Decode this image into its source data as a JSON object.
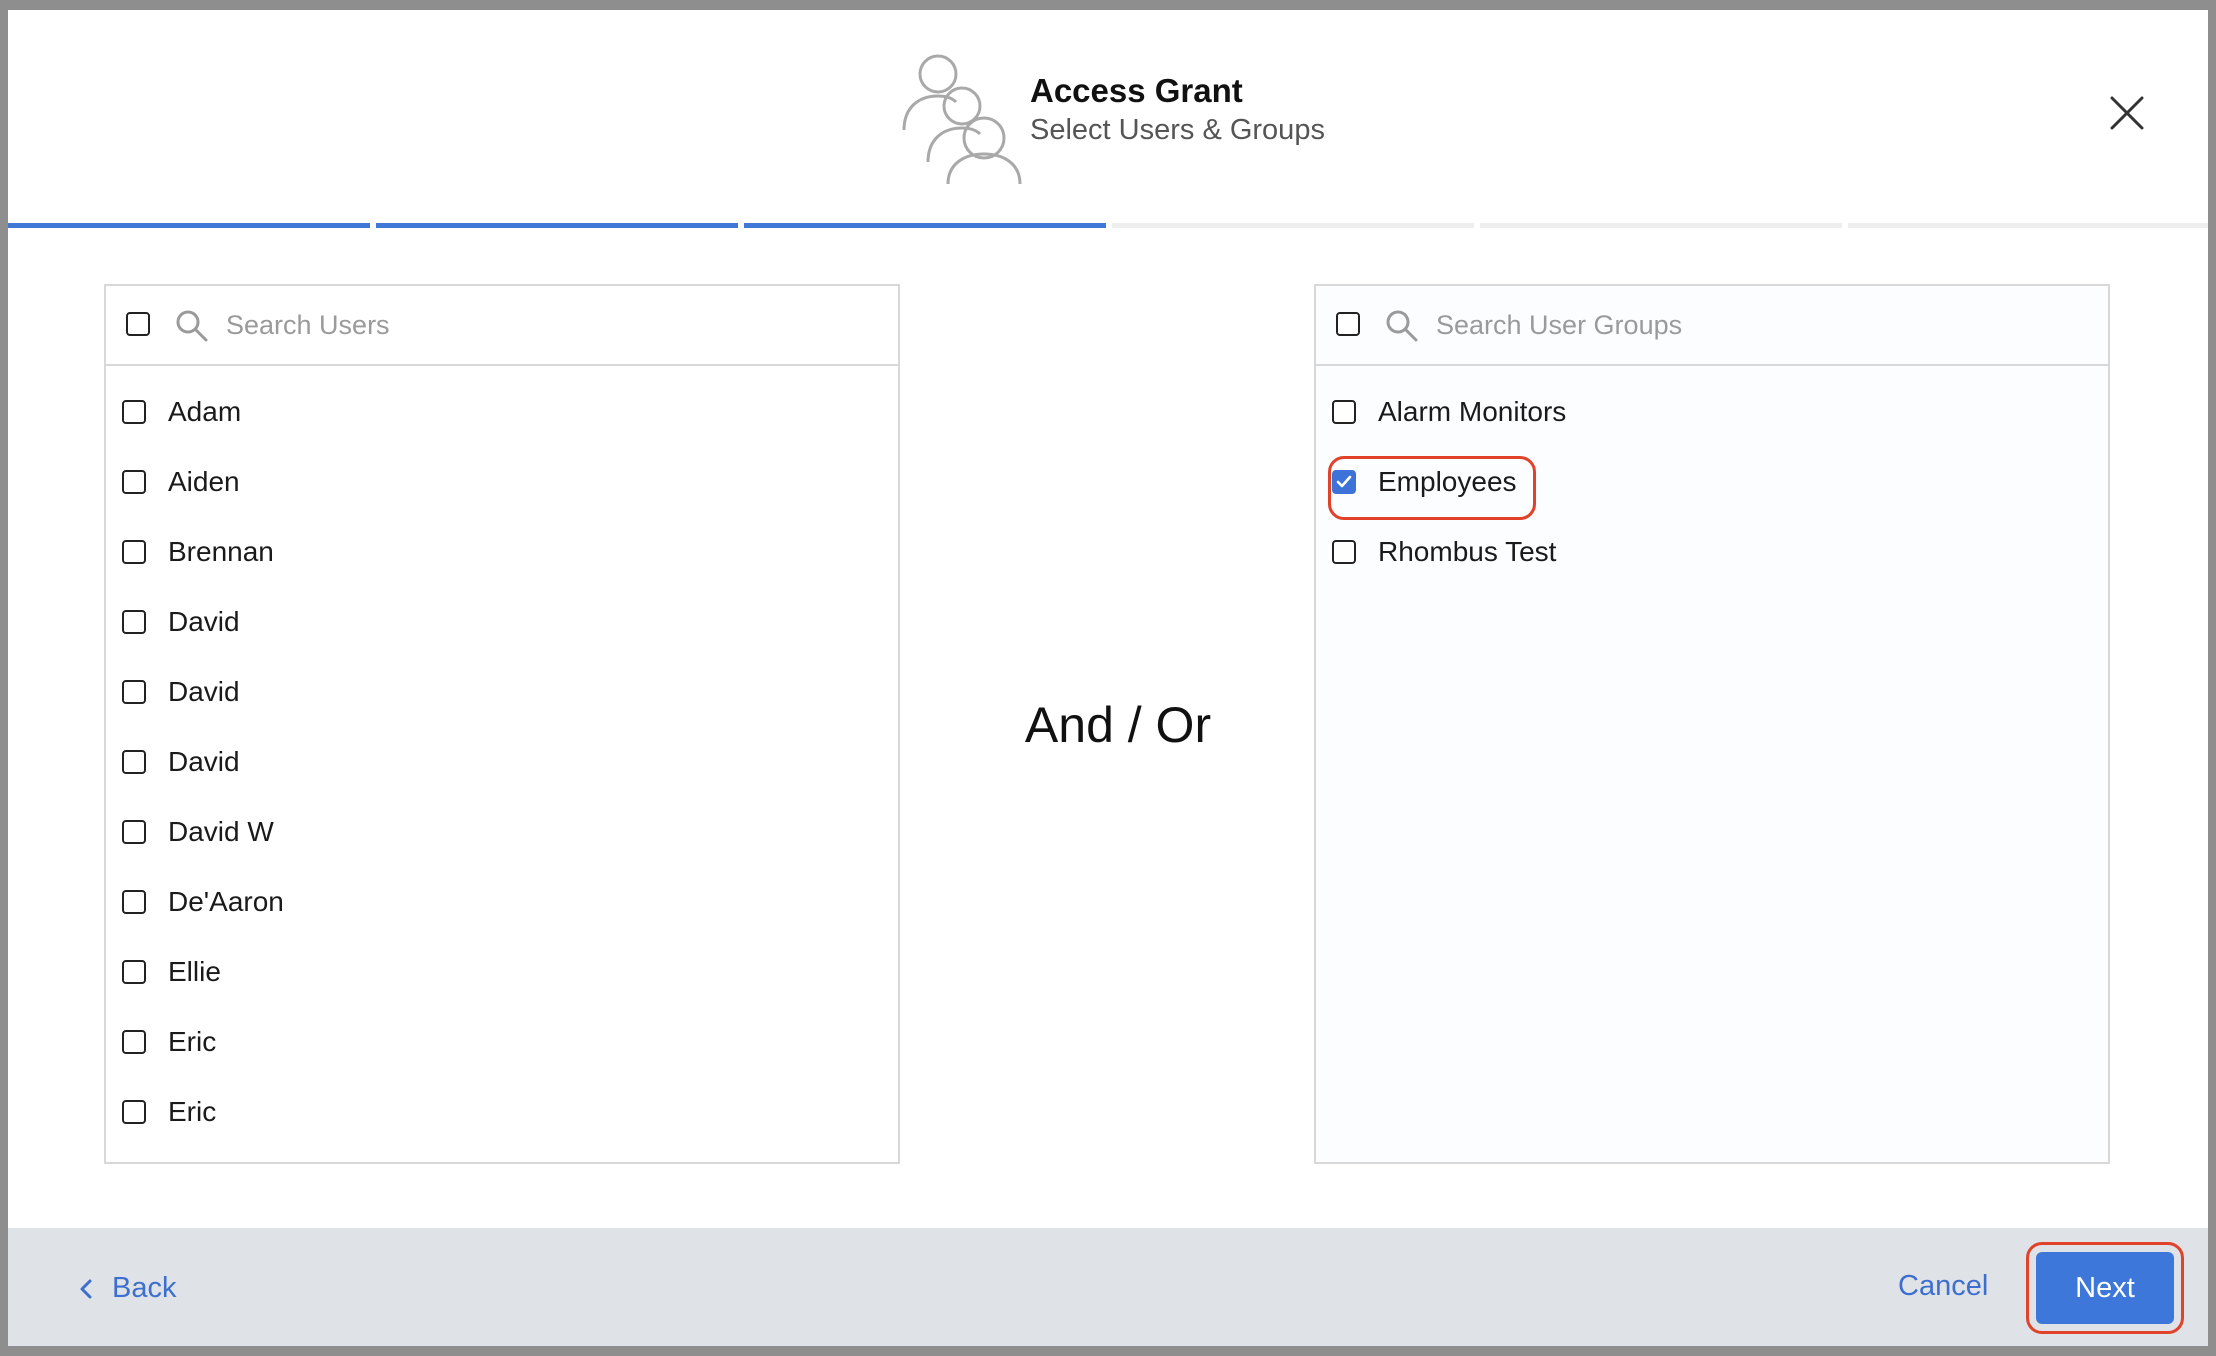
{
  "header": {
    "title": "Access Grant",
    "subtitle": "Select Users & Groups",
    "icon": "users-group-icon",
    "close_icon": "close-icon"
  },
  "progress": {
    "total_steps": 6,
    "completed_steps": 3,
    "active_color": "#3f79d5"
  },
  "users_panel": {
    "search_placeholder": "Search Users",
    "select_all_checked": false,
    "items": [
      {
        "label": "Adam",
        "checked": false
      },
      {
        "label": "Aiden",
        "checked": false
      },
      {
        "label": "Brennan",
        "checked": false
      },
      {
        "label": "David",
        "checked": false
      },
      {
        "label": "David",
        "checked": false
      },
      {
        "label": "David",
        "checked": false
      },
      {
        "label": "David W",
        "checked": false
      },
      {
        "label": "De'Aaron",
        "checked": false
      },
      {
        "label": "Ellie",
        "checked": false
      },
      {
        "label": "Eric",
        "checked": false
      },
      {
        "label": "Eric",
        "checked": false
      }
    ]
  },
  "separator": {
    "text": "And / Or"
  },
  "groups_panel": {
    "search_placeholder": "Search User Groups",
    "select_all_checked": false,
    "items": [
      {
        "label": "Alarm Monitors",
        "checked": false
      },
      {
        "label": "Employees",
        "checked": true
      },
      {
        "label": "Rhombus Test",
        "checked": false
      }
    ]
  },
  "footer": {
    "back_label": "Back",
    "cancel_label": "Cancel",
    "next_label": "Next",
    "accent_color": "#3d77d9",
    "highlight_color": "#e0422a"
  }
}
